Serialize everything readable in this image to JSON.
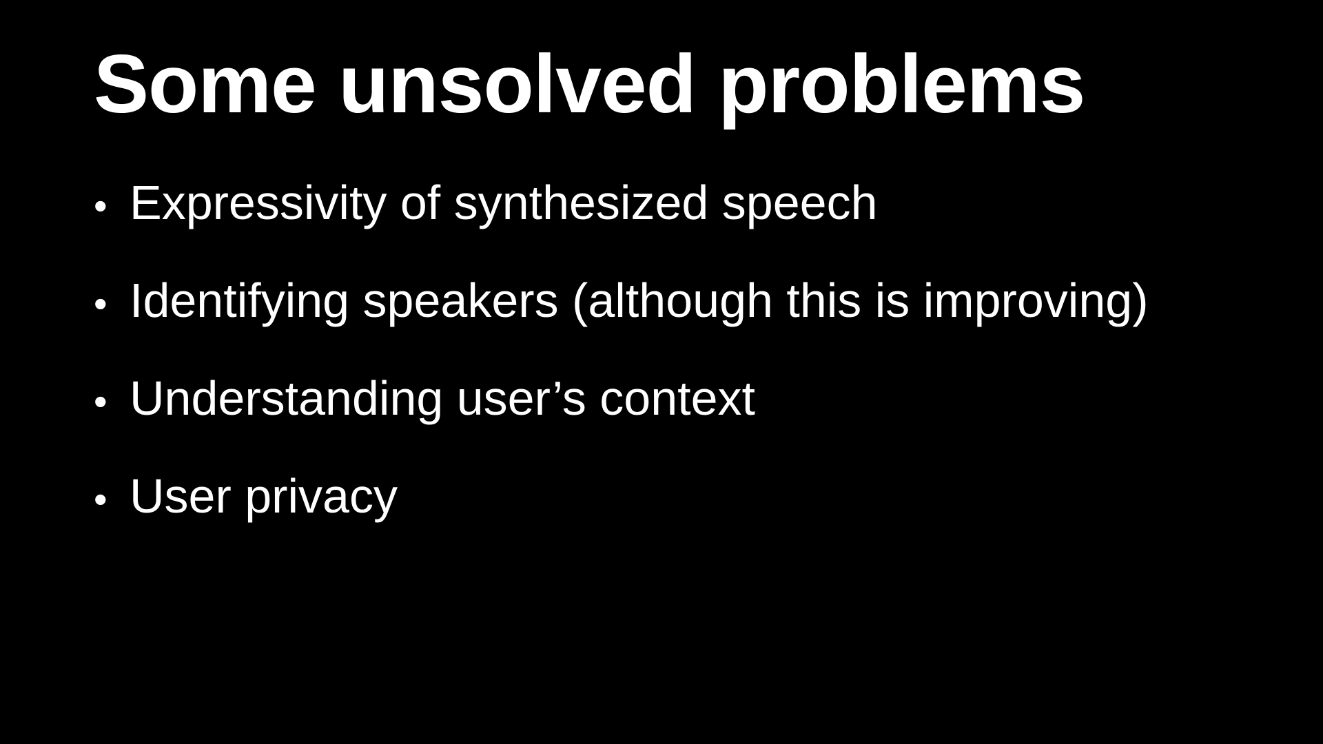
{
  "slide": {
    "title": "Some unsolved problems",
    "bullet_symbol": "•",
    "bullets": [
      "Expressivity of synthesized speech",
      "Identifying speakers (although this is improving)",
      "Understanding user’s context",
      "User privacy"
    ],
    "colors": {
      "background": "#000000",
      "text": "#ffffff"
    }
  }
}
